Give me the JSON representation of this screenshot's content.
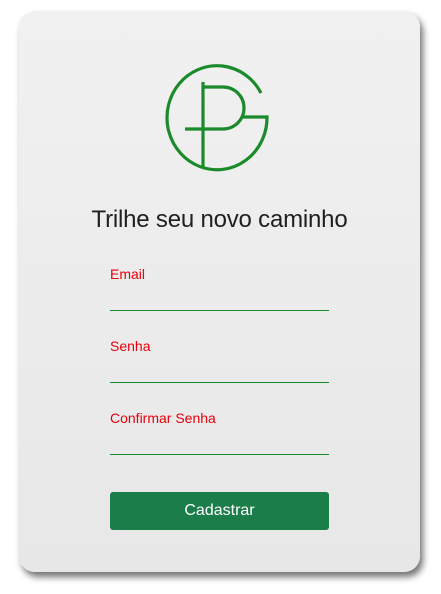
{
  "card": {
    "title": "Trilhe seu novo caminho"
  },
  "logo": {
    "icon": "gp-monogram-logo",
    "color": "#1a8a2a"
  },
  "form": {
    "email": {
      "label": "Email",
      "value": ""
    },
    "password": {
      "label": "Senha",
      "value": ""
    },
    "confirm_password": {
      "label": "Confirmar Senha",
      "value": ""
    },
    "submit_label": "Cadastrar"
  },
  "colors": {
    "label": "#e8000b",
    "underline": "#1a8a2a",
    "button": "#1b7d49"
  }
}
